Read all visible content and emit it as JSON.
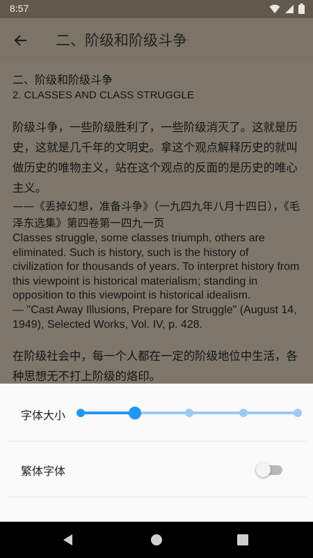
{
  "status_bar": {
    "time": "8:57"
  },
  "app_bar": {
    "title": "二、阶级和阶级斗争"
  },
  "content": {
    "heading_zh": "二、阶级和阶级斗争",
    "heading_en": "2. CLASSES AND CLASS STRUGGLE",
    "zh_paragraph": "阶级斗争，一些阶级胜利了，一些阶级消灭了。这就是历史，这就是几千年的文明史。拿这个观点解释历史的就叫做历史的唯物主义，站在这个观点的反面的是历史的唯心主义。",
    "zh_citation": "——《丢掉幻想，准备斗争》（一九四九年八月十四日），《毛泽东选集》第四卷第一四九一页",
    "en_paragraph": "Classes struggle, some classes triumph, others are eliminated. Such is history, such is the history of civilization for thousands of years. To interpret history from this viewpoint is historical materialism; standing in opposition to this viewpoint is historical idealism.",
    "en_citation": "— \"Cast Away Illusions, Prepare for Struggle\" (August 14, 1949), Selected Works, Vol. IV, p. 428.",
    "zh_paragraph_2": "在阶级社会中，每一个人都在一定的阶级地位中生活，各种思想无不打上阶级的烙印。"
  },
  "settings": {
    "font_size_label": "字体大小",
    "font_size_steps": 5,
    "font_size_selected_index": 1,
    "traditional_label": "繁体字体",
    "traditional_enabled": false
  },
  "colors": {
    "accent": "#2196f3",
    "accent_light": "#9ccbf4"
  },
  "icons": {
    "back": "arrow-left-icon",
    "wifi": "wifi-icon",
    "signal": "signal-icon",
    "battery": "battery-icon",
    "nav_back": "triangle-back-icon",
    "nav_home": "circle-home-icon",
    "nav_recents": "square-recents-icon"
  }
}
